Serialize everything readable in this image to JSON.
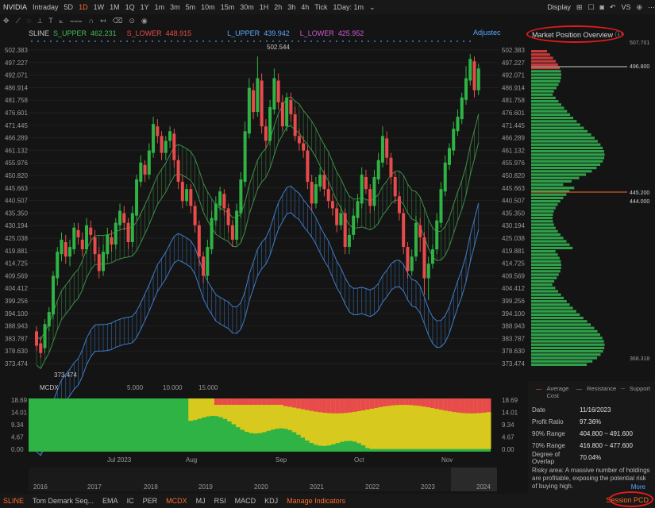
{
  "topbar": {
    "symbol": "NVIDIA",
    "intervals": [
      "Intraday",
      "5D",
      "1D",
      "1W",
      "1M",
      "1Q",
      "1Y",
      "1m",
      "3m",
      "5m",
      "10m",
      "15m",
      "30m",
      "1H",
      "2h",
      "3h",
      "4h",
      "Tick",
      "1Day: 1m"
    ],
    "active_interval": "1D",
    "display_label": "Display",
    "vs_label": "VS"
  },
  "indicator_row": {
    "name": "SLINE",
    "s_upper_label": "S_UPPER",
    "s_upper_value": "462.231",
    "s_lower_label": "S_LOWER",
    "s_lower_value": "448.915",
    "l_upper_label": "L_UPPER",
    "l_upper_value": "439.942",
    "l_lower_label": "L_LOWER",
    "l_lower_value": "425.952",
    "adjusted": "Adjustec"
  },
  "price_axis": [
    "502.383",
    "497.227",
    "492.071",
    "486.914",
    "481.758",
    "476.601",
    "471.445",
    "466.289",
    "461.132",
    "455.976",
    "450.820",
    "445.663",
    "440.507",
    "435.350",
    "430.194",
    "425.038",
    "419.881",
    "414.725",
    "409.569",
    "404.412",
    "399.256",
    "394.100",
    "388.943",
    "383.787",
    "378.630",
    "373.474"
  ],
  "chart": {
    "high_label": "502.544",
    "low_label": "373.474",
    "month_labels": [
      "Jul 2023",
      "Aug",
      "Sep",
      "Oct",
      "Nov"
    ]
  },
  "mcdx": {
    "name": "MCDX",
    "params": [
      "5.000",
      "10.000",
      "15.000"
    ],
    "axis": [
      "18.69",
      "14.01",
      "9.34",
      "4.67",
      "0.00"
    ]
  },
  "year_labels": [
    "2016",
    "2017",
    "2018",
    "2019",
    "2020",
    "2021",
    "2022",
    "2023",
    "2024"
  ],
  "mpo": {
    "title": "Market Position Overview",
    "top_price": "507.701",
    "bottom_price": "368.318",
    "level_1": "496.800",
    "level_2": "445.200",
    "level_3": "444.000",
    "legend": [
      "Average Cost",
      "Resistance",
      "Support"
    ],
    "info": [
      {
        "k": "Date",
        "v": "11/16/2023"
      },
      {
        "k": "Profit Ratio",
        "v": "97.36%"
      },
      {
        "k": "90% Range",
        "v": "404.800 ~ 491.600"
      },
      {
        "k": "70% Range",
        "v": "416.800 ~ 477.600"
      },
      {
        "k": "Degree of Overlap",
        "v": "70.04%"
      }
    ],
    "risky_text": "Risky area: A massive number of holdings are profitable, exposing the potential risk of buying high.",
    "more": "More"
  },
  "bottombar": {
    "items": [
      "SLINE",
      "Tom Demark Seq...",
      "EMA",
      "IC",
      "PER",
      "MCDX",
      "MJ",
      "RSI",
      "MACD",
      "KDJ",
      "Manage Indicators"
    ],
    "session": "Session PCD"
  },
  "colors": {
    "up": "#2fb344",
    "down": "#e84b4b",
    "accent": "#ff6a2a",
    "blue": "#5aa6ff"
  },
  "chart_data": {
    "type": "candlestick",
    "ylim": [
      370,
      505
    ],
    "candles": [
      [
        387,
        381,
        389,
        379
      ],
      [
        382,
        378,
        385,
        376
      ],
      [
        380,
        390,
        392,
        378
      ],
      [
        389,
        395,
        397,
        387
      ],
      [
        394,
        410,
        412,
        392
      ],
      [
        409,
        420,
        422,
        406
      ],
      [
        419,
        425,
        428,
        416
      ],
      [
        424,
        418,
        427,
        415
      ],
      [
        418,
        422,
        425,
        414
      ],
      [
        421,
        430,
        432,
        419
      ],
      [
        429,
        426,
        432,
        423
      ],
      [
        425,
        421,
        428,
        418
      ],
      [
        421,
        431,
        434,
        419
      ],
      [
        430,
        427,
        433,
        424
      ],
      [
        426,
        419,
        429,
        416
      ],
      [
        419,
        412,
        422,
        409
      ],
      [
        412,
        420,
        423,
        410
      ],
      [
        419,
        427,
        430,
        417
      ],
      [
        426,
        423,
        429,
        420
      ],
      [
        423,
        432,
        434,
        421
      ],
      [
        431,
        437,
        440,
        429
      ],
      [
        436,
        432,
        439,
        429
      ],
      [
        432,
        424,
        434,
        421
      ],
      [
        424,
        436,
        439,
        422
      ],
      [
        435,
        450,
        452,
        433
      ],
      [
        449,
        457,
        460,
        447
      ],
      [
        456,
        452,
        458,
        449
      ],
      [
        452,
        462,
        465,
        450
      ],
      [
        461,
        473,
        476,
        459
      ],
      [
        472,
        468,
        475,
        465
      ],
      [
        468,
        461,
        470,
        458
      ],
      [
        461,
        466,
        468,
        458
      ],
      [
        466,
        470,
        472,
        463
      ],
      [
        469,
        458,
        471,
        455
      ],
      [
        458,
        449,
        460,
        446
      ],
      [
        449,
        441,
        452,
        438
      ],
      [
        441,
        446,
        448,
        439
      ],
      [
        446,
        439,
        448,
        436
      ],
      [
        439,
        431,
        441,
        428
      ],
      [
        431,
        418,
        433,
        414
      ],
      [
        418,
        410,
        420,
        407
      ],
      [
        410,
        422,
        425,
        408
      ],
      [
        421,
        434,
        437,
        419
      ],
      [
        433,
        440,
        443,
        431
      ],
      [
        439,
        445,
        447,
        437
      ],
      [
        444,
        438,
        446,
        435
      ],
      [
        438,
        431,
        440,
        428
      ],
      [
        431,
        425,
        433,
        422
      ],
      [
        425,
        437,
        440,
        423
      ],
      [
        436,
        450,
        453,
        434
      ],
      [
        449,
        470,
        474,
        447
      ],
      [
        469,
        488,
        492,
        467
      ],
      [
        487,
        478,
        490,
        475
      ],
      [
        478,
        492,
        501,
        476
      ],
      [
        491,
        472,
        494,
        469
      ],
      [
        472,
        466,
        475,
        463
      ],
      [
        466,
        480,
        483,
        464
      ],
      [
        479,
        492,
        496,
        477
      ],
      [
        491,
        482,
        494,
        479
      ],
      [
        482,
        472,
        485,
        470
      ],
      [
        472,
        484,
        486,
        470
      ],
      [
        483,
        477,
        486,
        474
      ],
      [
        477,
        468,
        480,
        466
      ],
      [
        468,
        465,
        471,
        462
      ],
      [
        465,
        462,
        468,
        459
      ],
      [
        462,
        449,
        464,
        446
      ],
      [
        449,
        440,
        452,
        437
      ],
      [
        440,
        448,
        451,
        438
      ],
      [
        447,
        452,
        455,
        445
      ],
      [
        452,
        446,
        454,
        443
      ],
      [
        446,
        441,
        449,
        438
      ],
      [
        441,
        438,
        444,
        435
      ],
      [
        438,
        431,
        440,
        428
      ],
      [
        431,
        436,
        439,
        429
      ],
      [
        436,
        422,
        438,
        419
      ],
      [
        422,
        427,
        430,
        419
      ],
      [
        427,
        435,
        438,
        425
      ],
      [
        434,
        441,
        444,
        432
      ],
      [
        440,
        452,
        455,
        438
      ],
      [
        451,
        446,
        454,
        444
      ],
      [
        446,
        439,
        448,
        436
      ],
      [
        439,
        451,
        454,
        437
      ],
      [
        450,
        458,
        461,
        448
      ],
      [
        457,
        468,
        472,
        455
      ],
      [
        467,
        459,
        470,
        456
      ],
      [
        459,
        451,
        461,
        448
      ],
      [
        451,
        443,
        453,
        440
      ],
      [
        443,
        436,
        445,
        433
      ],
      [
        436,
        422,
        438,
        419
      ],
      [
        422,
        412,
        424,
        409
      ],
      [
        412,
        418,
        421,
        410
      ],
      [
        418,
        432,
        435,
        416
      ],
      [
        431,
        426,
        434,
        420
      ],
      [
        426,
        409,
        428,
        402
      ],
      [
        409,
        415,
        418,
        400
      ],
      [
        415,
        421,
        423,
        413
      ],
      [
        421,
        433,
        436,
        419
      ],
      [
        432,
        446,
        449,
        430
      ],
      [
        445,
        457,
        460,
        443
      ],
      [
        456,
        463,
        465,
        454
      ],
      [
        462,
        471,
        474,
        460
      ],
      [
        470,
        476,
        479,
        468
      ],
      [
        475,
        484,
        486,
        473
      ],
      [
        483,
        492,
        497,
        481
      ],
      [
        491,
        500,
        502,
        489
      ],
      [
        499,
        487,
        501,
        484
      ],
      [
        487,
        496,
        498,
        485
      ]
    ]
  }
}
